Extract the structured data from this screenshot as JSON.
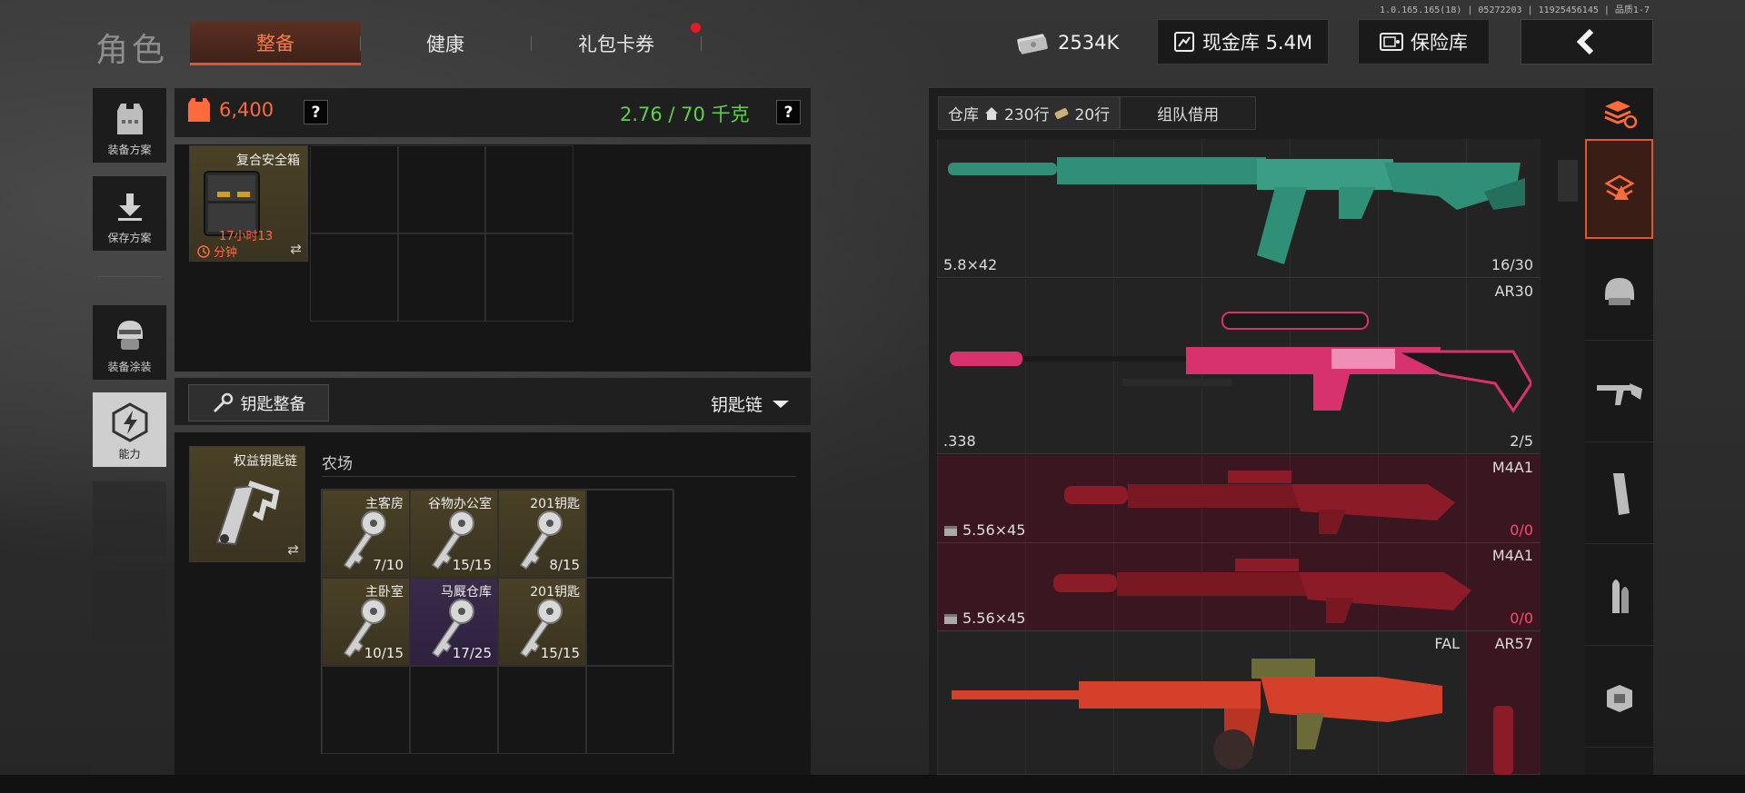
{
  "version": "1.0.165.165(18) | 05272203 | 11925456145 | 品质1-7",
  "header": {
    "title": "角色",
    "tabs": [
      {
        "label": "整备",
        "active": true
      },
      {
        "label": "健康",
        "active": false
      },
      {
        "label": "礼包卡券",
        "active": false,
        "badge_dot": true
      }
    ],
    "currency": "2534K",
    "cash_vault": "现金库 5.4M",
    "safe": "保险库"
  },
  "sidebar": {
    "items": [
      {
        "label": "装备方案",
        "icon": "vest-icon"
      },
      {
        "label": "保存方案",
        "icon": "download-icon"
      },
      {
        "label": "装备涂装",
        "icon": "helmet-icon"
      },
      {
        "label": "能力",
        "icon": "ability-icon",
        "active": true
      }
    ]
  },
  "loadout": {
    "value": "6,400",
    "weight": "2.76 / 70 千克",
    "help": "?",
    "secure_case": {
      "name": "复合安全箱",
      "timer_line1": "17小时13",
      "timer_line2": "分钟"
    }
  },
  "keys": {
    "button": "钥匙整备",
    "dropdown": "钥匙链",
    "keychain": {
      "name": "权益钥匙链"
    },
    "section": "农场",
    "items": [
      {
        "name": "主客房",
        "count": "7/10",
        "rarity": "gold"
      },
      {
        "name": "谷物办公室",
        "count": "15/15",
        "rarity": "gold"
      },
      {
        "name": "201钥匙",
        "count": "8/15",
        "rarity": "gold"
      },
      {
        "name": "主卧室",
        "count": "10/15",
        "rarity": "gold"
      },
      {
        "name": "马厩仓库",
        "count": "17/25",
        "rarity": "purple"
      },
      {
        "name": "201钥匙",
        "count": "15/15",
        "rarity": "gold"
      }
    ]
  },
  "warehouse": {
    "tabs": [
      {
        "label": "仓库",
        "active": true
      },
      {
        "label": "230行",
        "icon": "home-icon"
      },
      {
        "label": "20行",
        "icon": "ticket-icon"
      },
      {
        "label": "组队借用",
        "active": false
      }
    ],
    "weapons": [
      {
        "name": "",
        "caliber": "5.8×42",
        "ammo": "16/30",
        "color": "#2f8f77",
        "red": false
      },
      {
        "name": "AR30",
        "caliber": ".338",
        "ammo": "2/5",
        "color": "#d8326e",
        "red": false
      },
      {
        "name": "M4A1",
        "caliber": "5.56×45",
        "ammo": "0/0",
        "color": "#8a1b27",
        "red": true
      },
      {
        "name": "M4A1",
        "caliber": "5.56×45",
        "ammo": "0/0",
        "color": "#8a1b27",
        "red": true
      },
      {
        "name": "FAL",
        "caliber": "",
        "ammo": "",
        "color": "#d4402a",
        "red": false
      },
      {
        "name": "AR57",
        "caliber": "",
        "ammo": "",
        "color": "#8a1b27",
        "red": true
      }
    ],
    "categories": [
      "stack-refresh-icon",
      "layers-icon",
      "helmet-icon",
      "rifle-icon",
      "magazine-icon",
      "ammo-icon",
      "armor-icon"
    ]
  },
  "colors": {
    "accent": "#e0572a",
    "weight_green": "#5fd14a",
    "value_orange": "#ff6a3d",
    "ammo_zero": "#ff4a6e"
  }
}
